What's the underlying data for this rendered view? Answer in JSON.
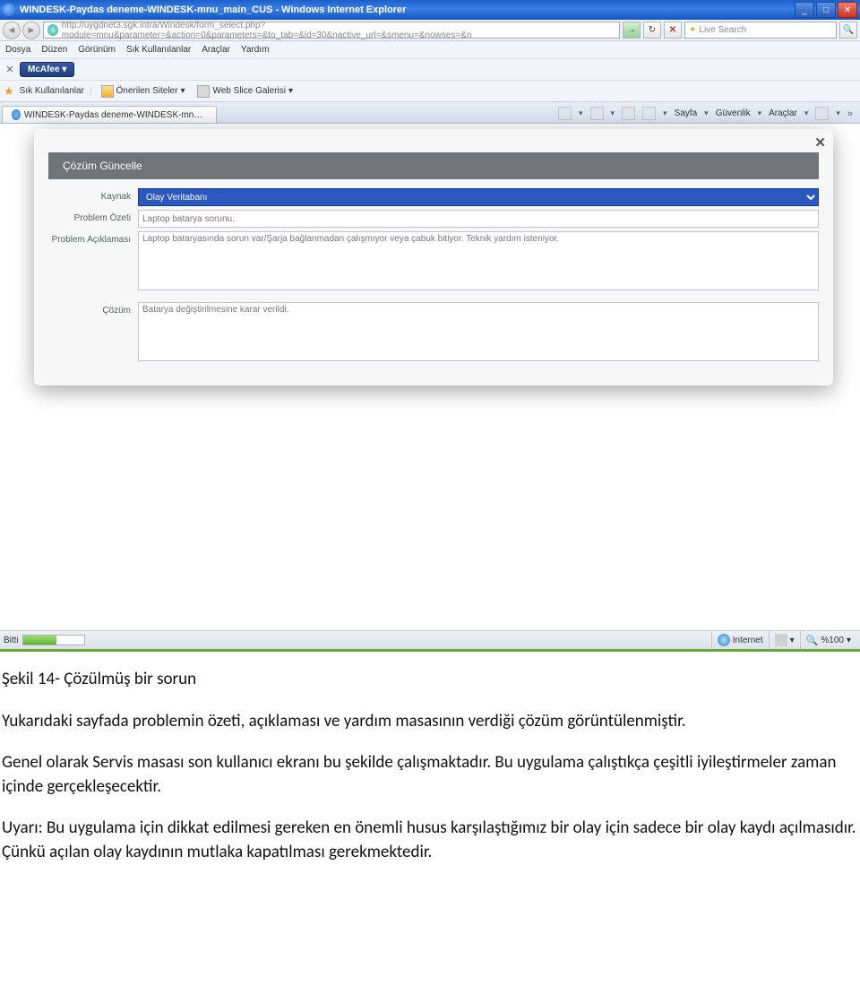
{
  "titlebar": {
    "title": "WINDESK-Paydas deneme-WINDESK-mnu_main_CUS - Windows Internet Explorer"
  },
  "address": {
    "url": "http://uygdnet3.sgk.intra/Windesk/form_select.php?module=mnu&parameter=&action=0&parameters=&to_tab=&id=30&nactive_url=&smenu=&nowses=&n",
    "search_placeholder": "Live Search"
  },
  "menubar": {
    "items": [
      "Dosya",
      "Düzen",
      "Görünüm",
      "Sık Kullanılanlar",
      "Araçlar",
      "Yardım"
    ]
  },
  "mcafee": {
    "label": "McAfee"
  },
  "favorites": {
    "label": "Sık Kullanılanlar",
    "suggested": "Önerilen Siteler",
    "webslice": "Web Slice Galerisi"
  },
  "tab": {
    "title": "WINDESK-Paydas deneme-WINDESK-mnu_main_CUS"
  },
  "cmdbar": {
    "page": "Sayfa",
    "safety": "Güvenlik",
    "tools": "Araçlar"
  },
  "modal": {
    "header": "Çözüm Güncelle",
    "labels": {
      "kaynak": "Kaynak",
      "problem_ozeti": "Problem Özeti",
      "problem_aciklamasi": "Problem Açıklaması",
      "cozum": "Çözüm"
    },
    "values": {
      "kaynak": "Olay Veritabanı",
      "problem_ozeti": "Laptop batarya sorunu.",
      "problem_aciklamasi": "Laptop bataryasında sorun var/Şarja bağlanmadan çalışmıyor veya çabuk bitiyor. Teknik yardım isteniyor.",
      "cozum": "Batarya değiştirilmesine karar verildi."
    }
  },
  "statusbar": {
    "left": "Bitti",
    "zone": "Internet",
    "zoom": "%100"
  },
  "doc": {
    "caption": "Şekil 14- Çözülmüş bir sorun",
    "p1": "Yukarıdaki sayfada problemin özeti, açıklaması ve yardım masasının verdiği çözüm görüntülenmiştir.",
    "p2": "Genel olarak Servis masası son kullanıcı ekranı bu şekilde çalışmaktadır. Bu uygulama çalıştıkça çeşitli iyileştirmeler zaman içinde gerçekleşecektir.",
    "p3": "Uyarı: Bu uygulama için dikkat edilmesi gereken en önemli husus karşılaştığımız bir olay için sadece bir olay kaydı açılmasıdır. Çünkü açılan olay kaydının mutlaka kapatılması gerekmektedir."
  }
}
